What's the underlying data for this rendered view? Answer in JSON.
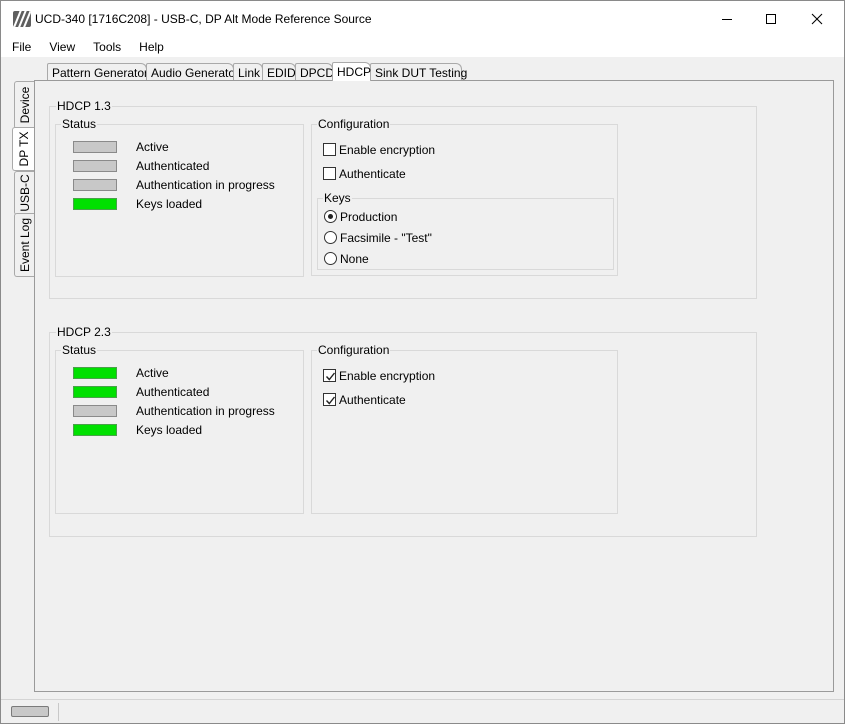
{
  "window": {
    "title": "UCD-340 [1716C208] - USB-C, DP Alt Mode Reference Source",
    "app_icon": "ucd-logo-icon"
  },
  "menu": {
    "items": [
      "File",
      "View",
      "Tools",
      "Help"
    ]
  },
  "side_tabs": [
    {
      "label": "Device"
    },
    {
      "label": "DP TX",
      "active": true
    },
    {
      "label": "USB-C"
    },
    {
      "label": "Event Log"
    }
  ],
  "top_tabs": [
    {
      "label": "Pattern Generator"
    },
    {
      "label": "Audio Generator"
    },
    {
      "label": "Link"
    },
    {
      "label": "EDID"
    },
    {
      "label": "DPCD"
    },
    {
      "label": "HDCP",
      "active": true
    },
    {
      "label": "Sink DUT Testing"
    }
  ],
  "hdcp13": {
    "title": "HDCP 1.3",
    "status": {
      "title": "Status",
      "items": [
        {
          "label": "Active",
          "on": false
        },
        {
          "label": "Authenticated",
          "on": false
        },
        {
          "label": "Authentication in progress",
          "on": false
        },
        {
          "label": "Keys loaded",
          "on": true
        }
      ]
    },
    "config": {
      "title": "Configuration",
      "enable_encryption": {
        "label": "Enable encryption",
        "checked": false
      },
      "authenticate": {
        "label": "Authenticate",
        "checked": false
      },
      "keys": {
        "title": "Keys",
        "options": [
          {
            "label": "Production",
            "selected": true
          },
          {
            "label": "Facsimile - \"Test\"",
            "selected": false
          },
          {
            "label": "None",
            "selected": false
          }
        ]
      }
    }
  },
  "hdcp23": {
    "title": "HDCP 2.3",
    "status": {
      "title": "Status",
      "items": [
        {
          "label": "Active",
          "on": true
        },
        {
          "label": "Authenticated",
          "on": true
        },
        {
          "label": "Authentication in progress",
          "on": false
        },
        {
          "label": "Keys loaded",
          "on": true
        }
      ]
    },
    "config": {
      "title": "Configuration",
      "enable_encryption": {
        "label": "Enable encryption",
        "checked": true
      },
      "authenticate": {
        "label": "Authenticate",
        "checked": true
      }
    }
  },
  "colors": {
    "led_on": "#00e000",
    "led_off": "#c8c8c8"
  }
}
